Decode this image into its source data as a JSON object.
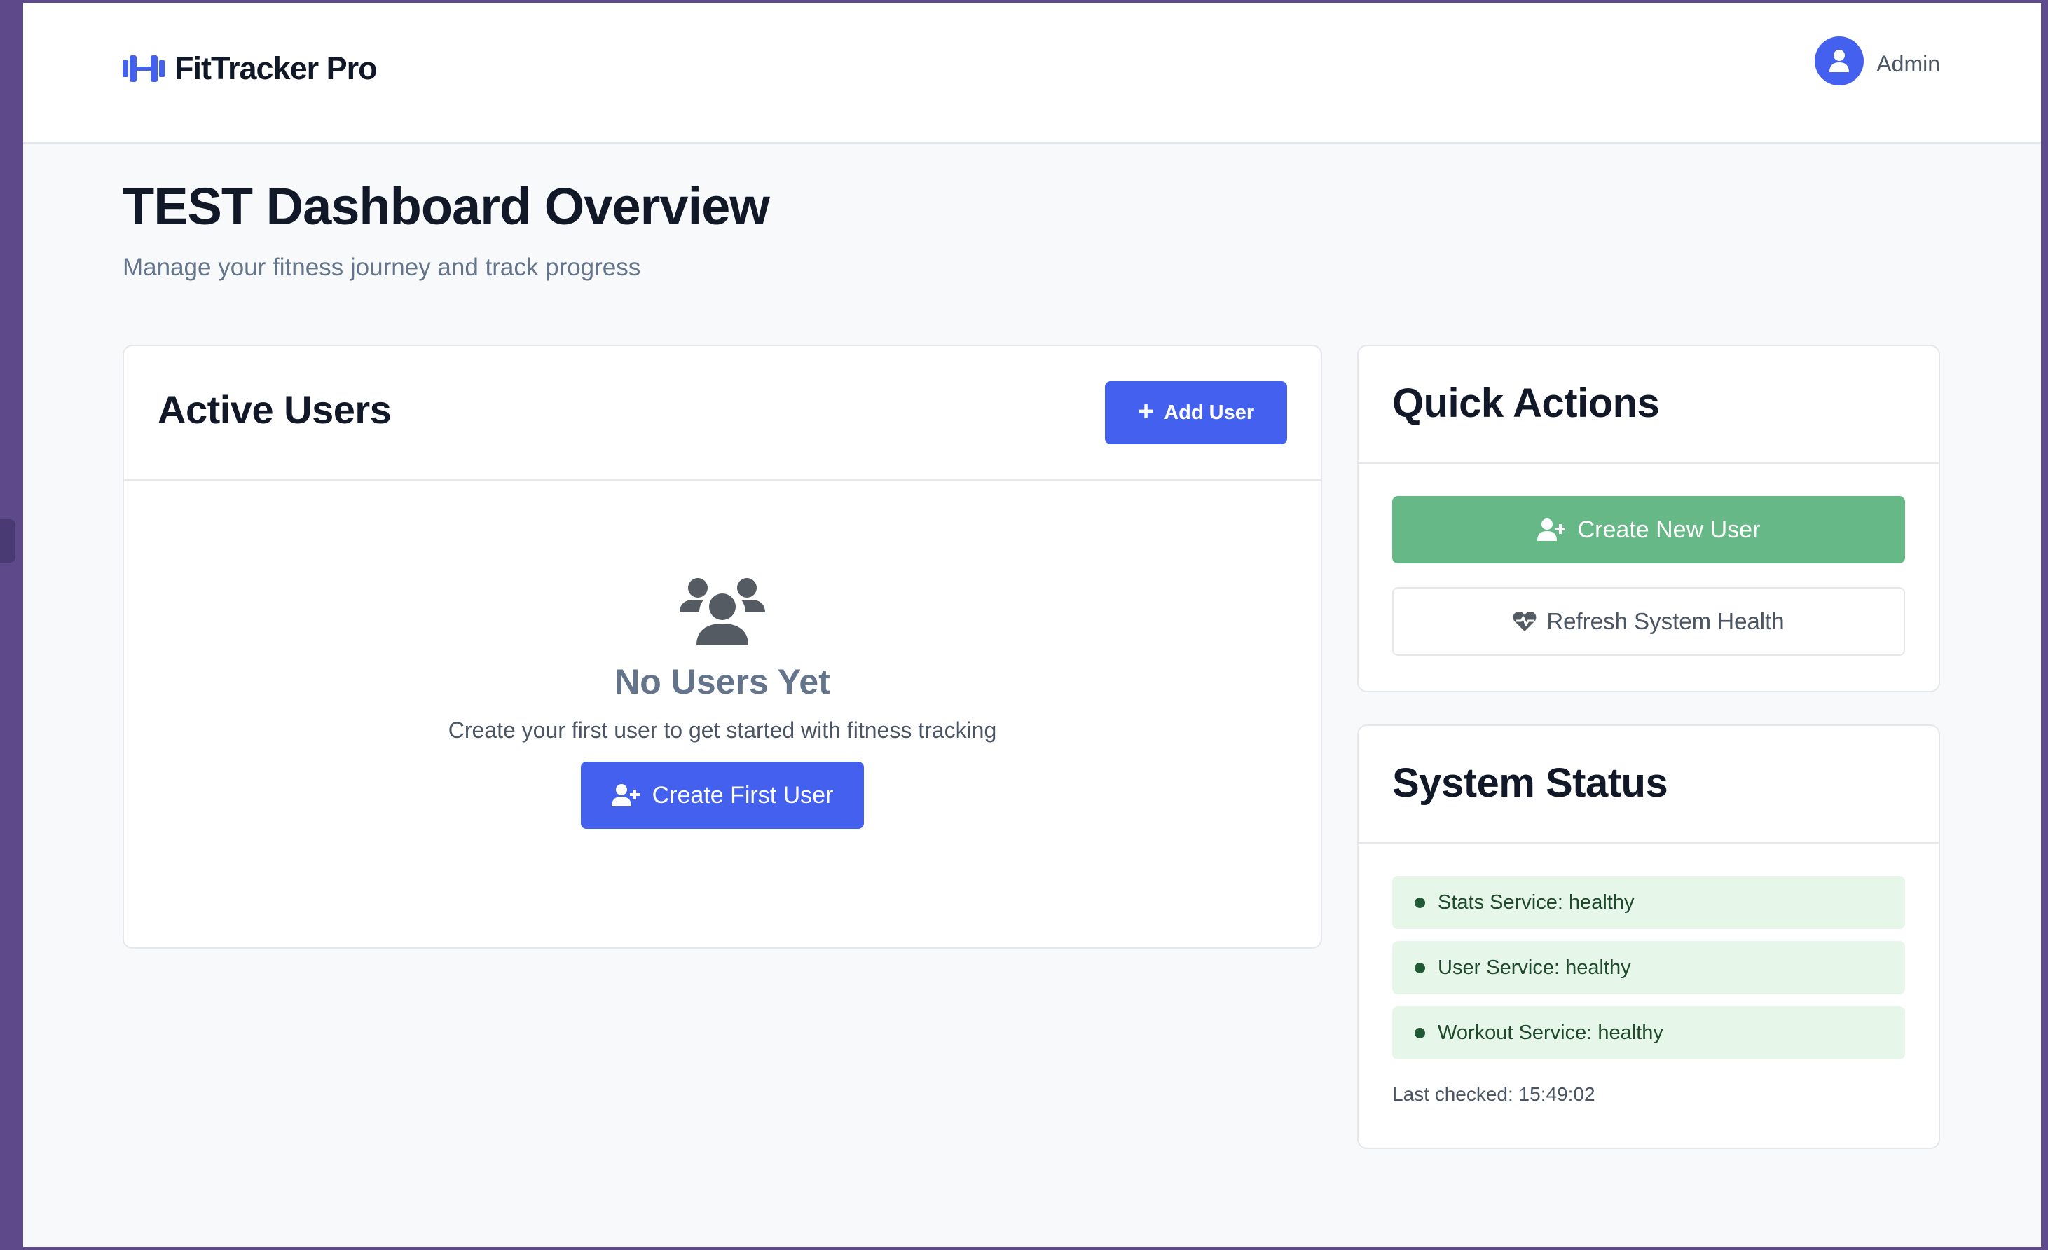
{
  "brand": {
    "name": "FitTracker Pro",
    "icon": "dumbbell-icon",
    "accent_color": "#4361ee"
  },
  "header": {
    "user_label": "Admin",
    "avatar_icon": "user-icon"
  },
  "page": {
    "title": "TEST Dashboard Overview",
    "subtitle": "Manage your fitness journey and track progress"
  },
  "active_users": {
    "title": "Active Users",
    "add_button_label": "Add User",
    "empty_state": {
      "icon": "users-icon",
      "title": "No Users Yet",
      "description": "Create your first user to get started with fitness tracking",
      "button_label": "Create First User"
    }
  },
  "quick_actions": {
    "title": "Quick Actions",
    "create_button_label": "Create New User",
    "create_button_color": "#66b886",
    "refresh_button_label": "Refresh System Health"
  },
  "system_status": {
    "title": "System Status",
    "services": [
      {
        "label": "Stats Service: healthy",
        "status_color": "#1f5a34"
      },
      {
        "label": "User Service: healthy",
        "status_color": "#1f5a34"
      },
      {
        "label": "Workout Service: healthy",
        "status_color": "#1f5a34"
      }
    ],
    "last_checked": "Last checked: 15:49:02"
  }
}
